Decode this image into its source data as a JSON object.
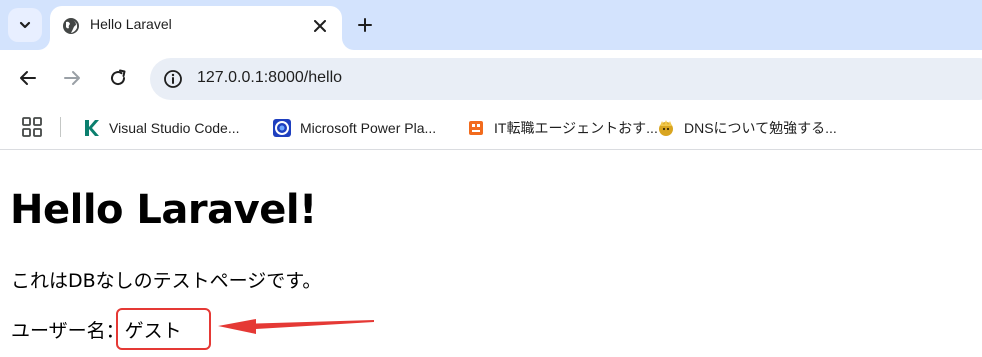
{
  "browser": {
    "tab": {
      "title": "Hello Laravel"
    },
    "address_bar": {
      "url": "127.0.0.1:8000/hello"
    },
    "bookmarks": [
      {
        "label": "Visual Studio Code...",
        "icon": "kotlin-k-icon"
      },
      {
        "label": "Microsoft Power Pla...",
        "icon": "power-platform-icon"
      },
      {
        "label": "IT転職エージェントおす...",
        "icon": "orange-character-icon"
      },
      {
        "label": "DNSについて勉強する...",
        "icon": "gold-character-icon"
      }
    ]
  },
  "page": {
    "title": "Hello Laravel!",
    "description": "これはDBなしのテストページです。",
    "user_label": "ユーザー名：",
    "user_name": "ゲスト"
  },
  "annotation": {
    "color": "#e53935"
  },
  "colors": {
    "tabstrip": "#d3e3fd",
    "omnibox": "#e9eef6"
  }
}
